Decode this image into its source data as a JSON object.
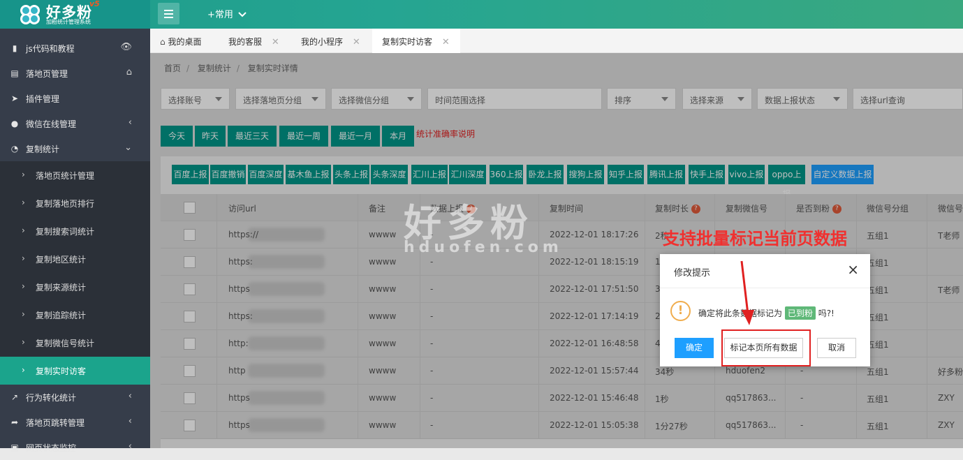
{
  "brand": {
    "name": "好多粉",
    "version": "v5",
    "subtitle": "加粉统计管理系统"
  },
  "header": {
    "common_menu": "+常用"
  },
  "sidebar": {
    "items": [
      {
        "label": "js代码和教程",
        "icon": "bookmark-icon",
        "right": "eye-icon"
      },
      {
        "label": "落地页管理",
        "icon": "page-icon",
        "right": "home-icon"
      },
      {
        "label": "插件管理",
        "icon": "send-icon",
        "right": ""
      },
      {
        "label": "微信在线管理",
        "icon": "wechat-icon",
        "right": "chevron-left-icon"
      },
      {
        "label": "复制统计",
        "icon": "pie-chart-icon",
        "right": "chevron-down-icon"
      }
    ],
    "sub_items": [
      {
        "label": "落地页统计管理"
      },
      {
        "label": "复制落地页排行"
      },
      {
        "label": "复制搜索词统计"
      },
      {
        "label": "复制地区统计"
      },
      {
        "label": "复制来源统计"
      },
      {
        "label": "复制追踪统计"
      },
      {
        "label": "复制微信号统计"
      },
      {
        "label": "复制实时访客",
        "active": true
      }
    ],
    "bottom_items": [
      {
        "label": "行为转化统计",
        "icon": "line-chart-icon"
      },
      {
        "label": "落地页跳转管理",
        "icon": "share-icon"
      },
      {
        "label": "网页状态监控",
        "icon": "monitor-icon"
      }
    ]
  },
  "tabs": [
    {
      "label": "我的桌面",
      "icon": "home-icon"
    },
    {
      "label": "我的客服"
    },
    {
      "label": "我的小程序"
    },
    {
      "label": "复制实时访客",
      "active": true
    }
  ],
  "breadcrumb": [
    "首页",
    "复制统计",
    "复制实时详情"
  ],
  "filters": [
    "选择账号",
    "选择落地页分组",
    "选择微信分组",
    "时间范围选择",
    "排序",
    "选择来源",
    "数据上报状态",
    "选择url查询"
  ],
  "quick_buttons": [
    "今天",
    "昨天",
    "最近三天",
    "最近一周",
    "最近一月",
    "本月"
  ],
  "accuracy_note": "统计准确率说明",
  "report_buttons": [
    "百度上报",
    "百度撤销",
    "百度深度",
    "基木鱼上报",
    "头条上报",
    "头条深度",
    "汇川上报",
    "汇川深度",
    "360上报",
    "卧龙上报",
    "搜狗上报",
    "知乎上报",
    "腾讯上报",
    "快手上报",
    "vivo上报",
    "oppo上报",
    "自定义数据上报"
  ],
  "table": {
    "headers": [
      "访问url",
      "备注",
      "数据上报",
      "复制时间",
      "复制时长",
      "复制微信号",
      "是否到粉",
      "微信号分组",
      "微信号"
    ],
    "rows": [
      {
        "url": "https://",
        "note": "wwww",
        "report": "-",
        "time": "2022-12-01 18:17:26",
        "dur": "2秒",
        "wx": "",
        "fan": "",
        "group": "五组1",
        "wxname": "T老师"
      },
      {
        "url": "https:",
        "note": "wwww",
        "report": "-",
        "time": "2022-12-01 18:15:19",
        "dur": "1",
        "wx": "",
        "fan": "",
        "group": "五组1",
        "wxname": ""
      },
      {
        "url": "https",
        "note": "wwww",
        "report": "-",
        "time": "2022-12-01 17:51:50",
        "dur": "3",
        "wx": "",
        "fan": "",
        "group": "五组1",
        "wxname": "T老师"
      },
      {
        "url": "https:",
        "note": "wwww",
        "report": "-",
        "time": "2022-12-01 17:14:19",
        "dur": "2",
        "wx": "",
        "fan": "",
        "group": "五组1",
        "wxname": ""
      },
      {
        "url": "http:",
        "note": "wwww",
        "report": "-",
        "time": "2022-12-01 16:48:58",
        "dur": "4",
        "wx": "",
        "fan": "",
        "group": "五组1",
        "wxname": ""
      },
      {
        "url": "http",
        "note": "wwww",
        "report": "-",
        "time": "2022-12-01 15:57:44",
        "dur": "34秒",
        "wx": "hduofen2",
        "fan": "-",
        "group": "五组1",
        "wxname": "好多粉"
      },
      {
        "url": "https",
        "note": "wwww",
        "report": "-",
        "time": "2022-12-01 15:46:48",
        "dur": "1秒",
        "wx": "qq517863...",
        "fan": "-",
        "group": "五组1",
        "wxname": "ZXY"
      },
      {
        "url": "https",
        "note": "wwww",
        "report": "-",
        "time": "2022-12-01 15:05:38",
        "dur": "1分27秒",
        "wx": "qq517863...",
        "fan": "-",
        "group": "五组1",
        "wxname": "ZXY"
      }
    ]
  },
  "watermark": {
    "cn": "好多粉",
    "en": "hduofen.com"
  },
  "callout": "支持批量标记当前页数据",
  "dialog": {
    "title": "修改提示",
    "message_pre": "确定将此条数据标记为",
    "badge": "已到粉",
    "message_post": "吗?!",
    "confirm": "确定",
    "mark_all": "标记本页所有数据",
    "cancel": "取消"
  },
  "colors": {
    "primary": "#009688",
    "blue": "#1e9fff",
    "warning": "#f0ad4e",
    "red": "#e02020"
  }
}
